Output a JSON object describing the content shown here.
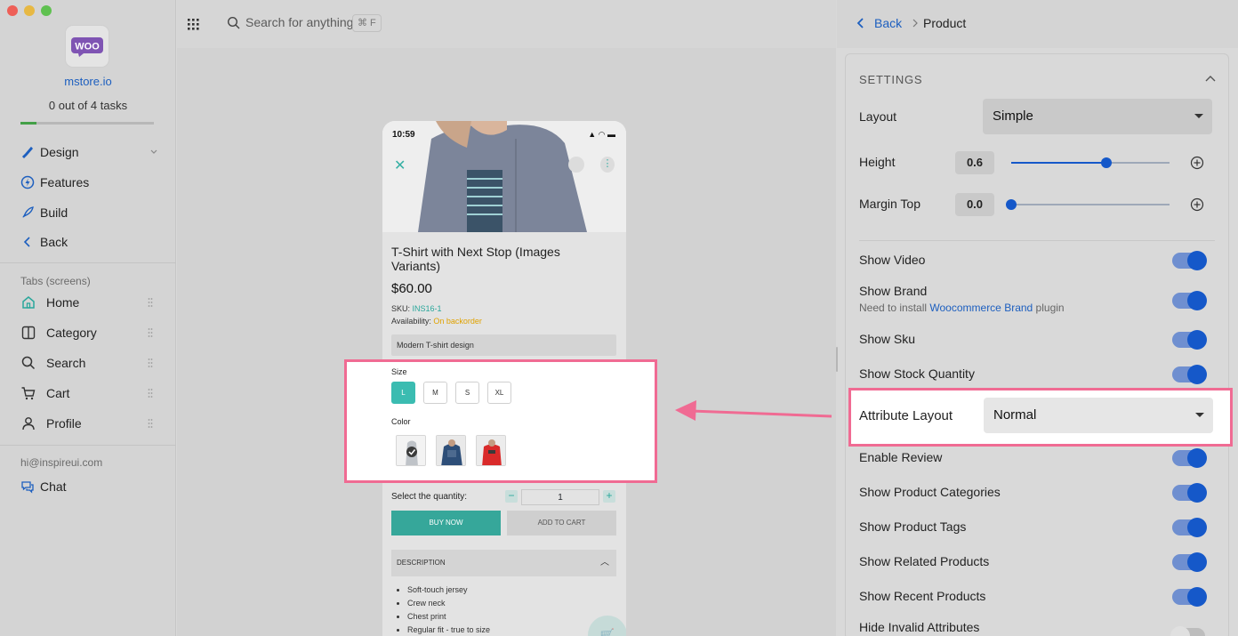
{
  "sidebar": {
    "store_name": "mstore.io",
    "tasks": "0 out of 4 tasks",
    "tasks_progress": 0.12,
    "nav": [
      {
        "label": "Design",
        "icon": "brush-icon"
      },
      {
        "label": "Features",
        "icon": "bolt-icon"
      },
      {
        "label": "Build",
        "icon": "rocket-icon"
      },
      {
        "label": "Back",
        "icon": "chevron-left-icon"
      }
    ],
    "tabs_label": "Tabs (screens)",
    "tabs": [
      {
        "label": "Home",
        "icon": "home-icon"
      },
      {
        "label": "Category",
        "icon": "columns-icon"
      },
      {
        "label": "Search",
        "icon": "search-icon"
      },
      {
        "label": "Cart",
        "icon": "cart-icon"
      },
      {
        "label": "Profile",
        "icon": "user-icon"
      }
    ],
    "email": "hi@inspireui.com",
    "chat": "Chat"
  },
  "topbar": {
    "search_placeholder": "Search for anything",
    "shortcut": "⌘ F"
  },
  "phone": {
    "time": "10:59",
    "title": "T-Shirt with Next Stop (Images Variants)",
    "price": "$60.00",
    "sku_label": "SKU:",
    "sku_value": "INS16-1",
    "availability_label": "Availability:",
    "availability_value": "On backorder",
    "short_desc": "Modern T-shirt design",
    "quantity_label": "Select the quantity:",
    "quantity_value": "1",
    "buy_now": "BUY NOW",
    "add_to_cart": "ADD TO CART",
    "description_header": "DESCRIPTION",
    "bullets": [
      "Soft-touch jersey",
      "Crew neck",
      "Chest print",
      "Regular fit - true to size"
    ]
  },
  "attribute_preview": {
    "size_label": "Size",
    "sizes": [
      "L",
      "M",
      "S",
      "XL"
    ],
    "selected_size": "L",
    "color_label": "Color"
  },
  "right_panel": {
    "back": "Back",
    "current": "Product",
    "settings_title": "SETTINGS",
    "layout_label": "Layout",
    "layout_value": "Simple",
    "height_label": "Height",
    "height_value": "0.6",
    "height_fraction": 0.6,
    "margin_top_label": "Margin Top",
    "margin_top_value": "0.0",
    "margin_top_fraction": 0.0,
    "show_video": "Show Video",
    "show_brand": "Show Brand",
    "brand_note_prefix": "Need to install ",
    "brand_note_link": "Woocommerce Brand",
    "brand_note_suffix": " plugin",
    "show_sku": "Show Sku",
    "show_stock": "Show Stock Quantity",
    "attribute_layout_label": "Attribute Layout",
    "attribute_layout_value": "Normal",
    "enable_review": "Enable Review",
    "show_categories": "Show Product Categories",
    "show_tags": "Show Product Tags",
    "show_related": "Show Related Products",
    "show_recent": "Show Recent Products",
    "hide_invalid": "Hide Invalid Attributes"
  },
  "colors": {
    "accent_blue": "#1558c9",
    "teal": "#36a79a",
    "highlight_pink": "#f06b93"
  }
}
